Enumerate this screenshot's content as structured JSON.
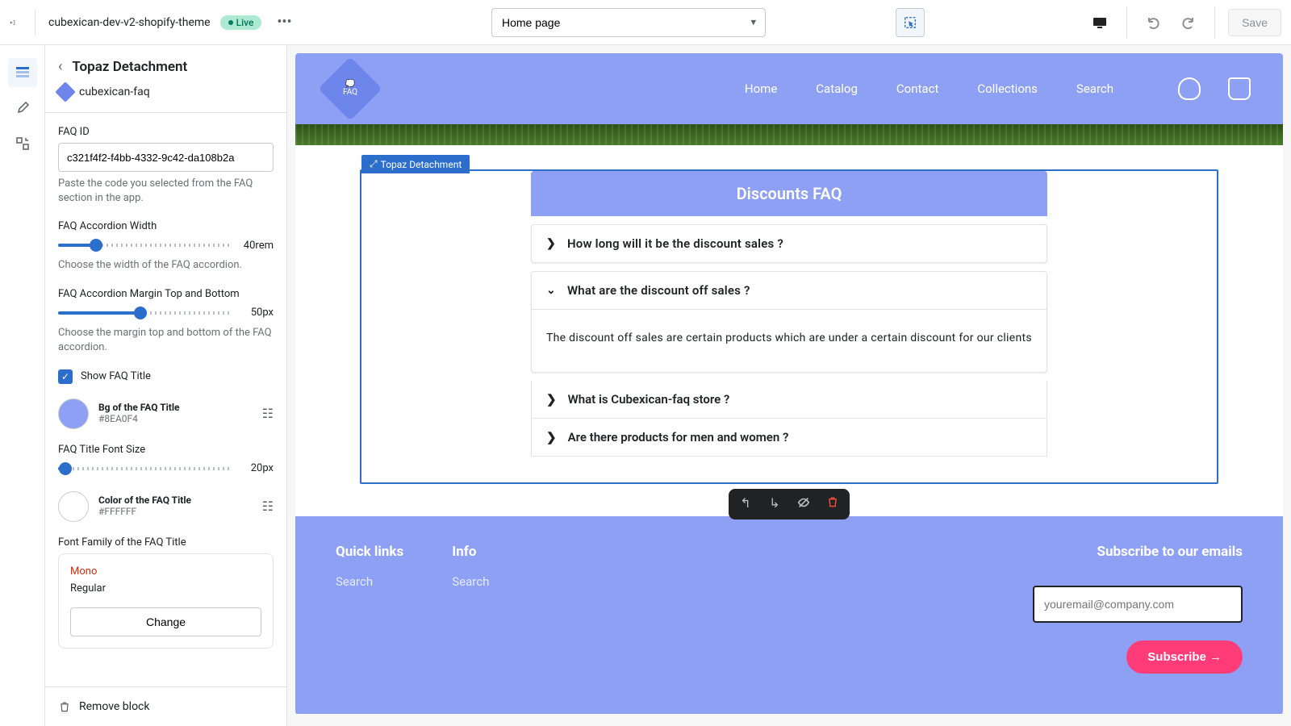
{
  "topbar": {
    "theme_name": "cubexican-dev-v2-shopify-theme",
    "status": "Live",
    "page_selector": "Home page",
    "save_label": "Save"
  },
  "sidebar": {
    "title": "Topaz Detachment",
    "app_name": "cubexican-faq",
    "faq_id": {
      "label": "FAQ ID",
      "value": "c321f4f2-f4bb-4332-9c42-da108b2a",
      "help": "Paste the code you selected from the FAQ section in the app."
    },
    "width": {
      "label": "FAQ Accordion Width",
      "value": "40rem",
      "help": "Choose the width of the FAQ accordion."
    },
    "margin": {
      "label": "FAQ Accordion Margin Top and Bottom",
      "value": "50px",
      "help": "Choose the margin top and bottom of the FAQ accordion."
    },
    "show_title": {
      "label": "Show FAQ Title"
    },
    "bg_color": {
      "label": "Bg of the FAQ Title",
      "hex": "#8EA0F4"
    },
    "title_size": {
      "label": "FAQ Title Font Size",
      "value": "20px"
    },
    "title_color": {
      "label": "Color of the FAQ Title",
      "hex": "#FFFFFF"
    },
    "font_family": {
      "label": "Font Family of the FAQ Title",
      "v1": "Mono",
      "v2": "Regular",
      "change": "Change"
    },
    "remove": "Remove block"
  },
  "preview": {
    "nav": [
      "Home",
      "Catalog",
      "Contact",
      "Collections",
      "Search"
    ],
    "logo_text": "FAQ",
    "section_tag": "Topaz Detachment",
    "faq_title": "Discounts FAQ",
    "q1": "How long will it be the discount sales ?",
    "q2": "What are the discount off sales ?",
    "a2": "The discount off sales are certain products which are under a certain discount for our clients",
    "q3": "What is Cubexican-faq store ?",
    "q4": "Are there products for men and women ?",
    "footer": {
      "col1_h": "Quick links",
      "col1_a": "Search",
      "col2_h": "Info",
      "col2_a": "Search",
      "sub_h": "Subscribe to our emails",
      "email_ph": "youremail@company.com",
      "sub_btn": "Subscribe →"
    }
  }
}
